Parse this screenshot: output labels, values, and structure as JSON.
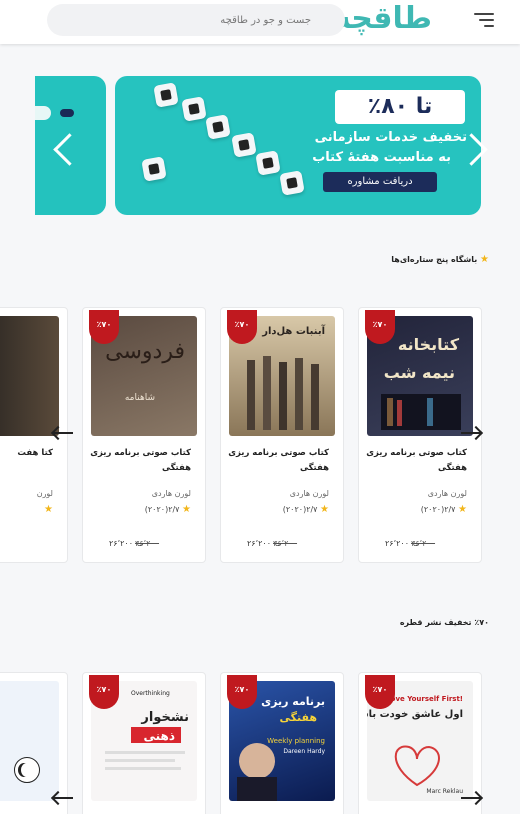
{
  "header": {
    "logo_text": "طاقچه",
    "search_placeholder": "جست و جو در طاقچه"
  },
  "banner": {
    "title": "تا ۸۰٪",
    "line1": "تخفیف خدمات سازمانی",
    "line2": "به مناسبت هفتهٔ کتاب",
    "cta": "دریافت مشاوره"
  },
  "sections": [
    {
      "title": "باشگاه پنج ستاره‌ای‌ها",
      "products": [
        {
          "badge": "٪۷۰",
          "title": "کتاب صوتی برنامه ریزی هفتگی",
          "author": "لورن هاردی",
          "rating": "۲/۷(۲۰۲۰)",
          "price_old": "۳۶٬۲۰۰",
          "price_new": "۲۶٬۲۰۰",
          "currency": "ت"
        },
        {
          "badge": "٪۷۰",
          "title": "کتاب صوتی برنامه ریزی هفتگی",
          "author": "لورن هاردی",
          "rating": "۲/۷(۲۰۲۰)",
          "price_old": "۳۶٬۲۰۰",
          "price_new": "۲۶٬۲۰۰",
          "currency": "ت"
        },
        {
          "badge": "٪۷۰",
          "title": "کتاب صوتی برنامه ریزی هفتگی",
          "author": "لورن هاردی",
          "rating": "۲/۷(۲۰۲۰)",
          "price_old": "۳۶٬۲۰۰",
          "price_new": "۲۶٬۲۰۰",
          "currency": "ت"
        },
        {
          "title_fragment": "کتا هفت",
          "author_fragment": "لورن"
        }
      ],
      "covers": [
        {
          "lines": [
            "کتابخانه",
            "نیمه شب"
          ],
          "colors": [
            "#1b1d2b",
            "#3a3f5a"
          ]
        },
        {
          "lines": [
            "آبنبات هل‌دار"
          ],
          "colors": [
            "#c9b89a",
            "#6b5a48"
          ]
        },
        {
          "lines": [
            "فردوسی",
            "شاهنامه"
          ],
          "colors": [
            "#4a3b33",
            "#8a7866"
          ]
        }
      ]
    },
    {
      "title": "٪۷۰ تخفیف نشر قطره",
      "products": [
        {
          "badge": "٪۷۰"
        },
        {
          "badge": "٪۷۰"
        },
        {
          "badge": "٪۷۰"
        },
        {}
      ],
      "covers": [
        {
          "lines": [
            "اول عاشق خودت باش",
            "Love Yourself First!",
            "Marc Reklau"
          ],
          "colors": [
            "#f3f3f3",
            "#e8d6d6"
          ]
        },
        {
          "lines": [
            "برنامه ریزی",
            "هفتگی",
            "Weekly planning",
            "Dareen Hardy"
          ],
          "colors": [
            "#1e3f86",
            "#0b1b4f"
          ]
        },
        {
          "lines": [
            "Overthinking",
            "نشخوار",
            "ذهنی"
          ],
          "colors": [
            "#f7f7f7",
            "#f1e4e4"
          ]
        }
      ]
    }
  ]
}
